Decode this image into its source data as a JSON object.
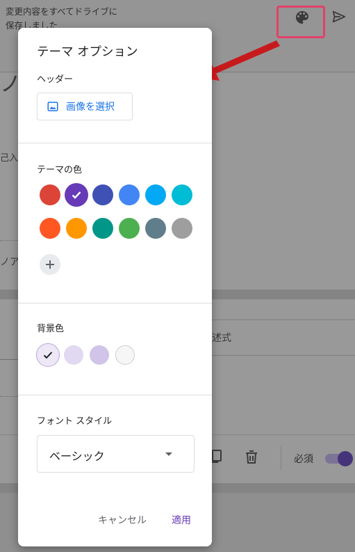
{
  "header": {
    "save_status_line1": "変更内容をすべてドライブに",
    "save_status_line2": "保存しました",
    "palette_icon": "palette-icon",
    "send_icon": "send-icon"
  },
  "background": {
    "title_fragment": "ノ",
    "fragment_a": "己入",
    "fragment_b": "ノア",
    "fragment_c": "述式",
    "copy_icon": "copy-icon",
    "delete_icon": "trash-icon",
    "required_label": "必須",
    "required_toggle_on": true
  },
  "dialog": {
    "title": "テーマ オプション",
    "header_section_label": "ヘッダー",
    "select_image_label": "画像を選択",
    "image_icon": "image-icon",
    "theme_color_label": "テーマの色",
    "theme_colors": [
      {
        "color": "#db4437",
        "selected": false
      },
      {
        "color": "#673ab7",
        "selected": true
      },
      {
        "color": "#3f51b5",
        "selected": false
      },
      {
        "color": "#4285f4",
        "selected": false
      },
      {
        "color": "#03a9f4",
        "selected": false
      },
      {
        "color": "#00bcd4",
        "selected": false
      },
      {
        "color": "#ff5722",
        "selected": false
      },
      {
        "color": "#ff9800",
        "selected": false
      },
      {
        "color": "#009688",
        "selected": false
      },
      {
        "color": "#4caf50",
        "selected": false
      },
      {
        "color": "#607d8b",
        "selected": false
      },
      {
        "color": "#9e9e9e",
        "selected": false
      }
    ],
    "add_color_icon": "plus-icon",
    "background_color_label": "背景色",
    "background_colors": [
      {
        "color": "#ede7f6",
        "selected": true
      },
      {
        "color": "#e1d8f1",
        "selected": false
      },
      {
        "color": "#d1c4e9",
        "selected": false
      },
      {
        "color": "#f6f6f6",
        "selected": false
      }
    ],
    "font_style_label": "フォント スタイル",
    "font_style_value": "ベーシック",
    "cancel_label": "キャンセル",
    "apply_label": "適用"
  },
  "colors": {
    "accent": "#673ab7",
    "link_blue": "#1a73e8",
    "highlight": "#e4406a",
    "arrow": "#e0191c"
  }
}
